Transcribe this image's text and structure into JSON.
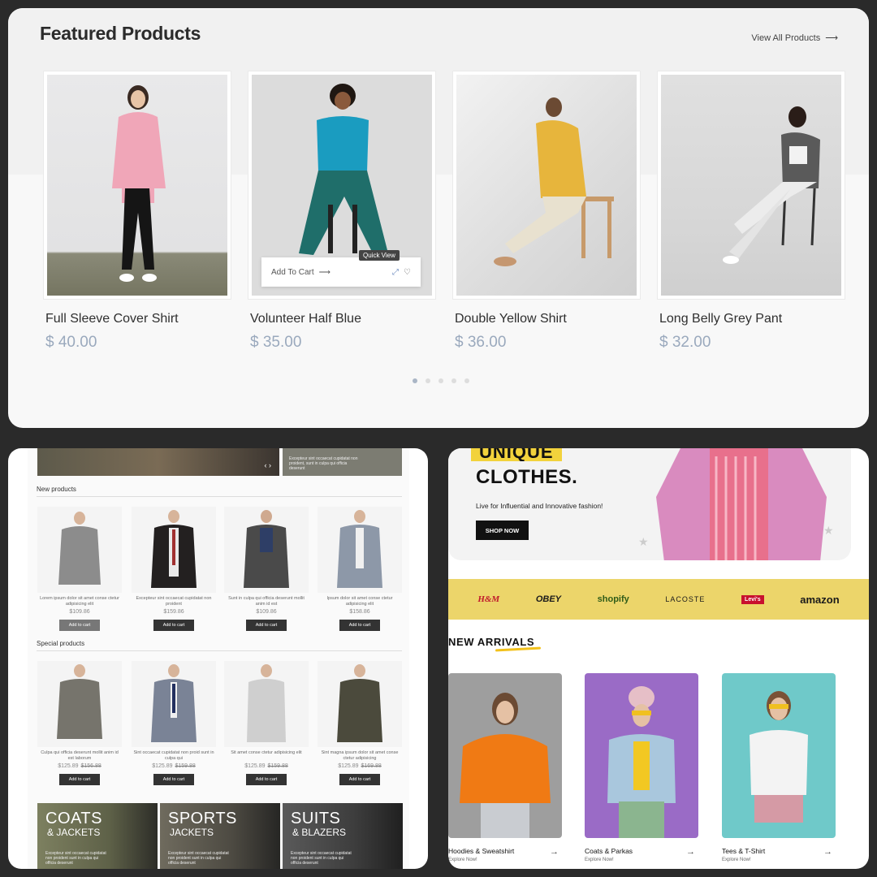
{
  "featured": {
    "title": "Featured Products",
    "view_all": "View All Products",
    "products": [
      {
        "name": "Full Sleeve Cover Shirt",
        "price": "$ 40.00"
      },
      {
        "name": "Volunteer Half Blue",
        "price": "$ 35.00"
      },
      {
        "name": "Double Yellow Shirt",
        "price": "$ 36.00"
      },
      {
        "name": "Long Belly Grey Pant",
        "price": "$ 32.00"
      }
    ],
    "add_to_cart": "Add To Cart",
    "quick_view": "Quick View",
    "active_slide": 1,
    "slide_count": 5
  },
  "shop": {
    "new_products_label": "New products",
    "special_products_label": "Special products",
    "new_products": [
      {
        "desc": "Lorem ipsum dolor sit amet conse ctetur adipisicing elit",
        "price": "$109.86",
        "btn": "Add to cart"
      },
      {
        "desc": "Excepteur sint occaecat cupidatat non proident",
        "price": "$159.86",
        "btn": "Add to cart"
      },
      {
        "desc": "Sunt in culpa qui officia deserunt mollit anim id est",
        "price": "$109.86",
        "btn": "Add to cart"
      },
      {
        "desc": "Ipsum dolor sit amet conse ctetur adipisicing elit",
        "price": "$158.86",
        "btn": "Add to cart"
      }
    ],
    "special_products": [
      {
        "desc": "Culpa qui officia deserunt mollit anim id est laborum",
        "price": "$125.89",
        "old": "$156.88",
        "btn": "Add to cart"
      },
      {
        "desc": "Sint occaecat cupidatat non proid sunt in culpa qui",
        "price": "$125.89",
        "old": "$159.88",
        "btn": "Add to cart"
      },
      {
        "desc": "Sit amet conse ctetur adipisicing elit",
        "price": "$125.89",
        "old": "$159.88",
        "btn": "Add to cart"
      },
      {
        "desc": "Sint magna ipsum dolor sit amet conse ctetur adipisicing",
        "price": "$125.89",
        "old": "$169.88",
        "btn": "Add to cart"
      }
    ],
    "categories": [
      {
        "t1": "COATS",
        "t2": "& JACKETS",
        "t3": "Excepteur sint occaecat cupidatat non proident sunt in culpa qui officia deserunt"
      },
      {
        "t1": "SPORTS",
        "t2": "JACKETS",
        "t3": "Excepteur sint occaecat cupidatat non proident sunt in culpa qui officia deserunt"
      },
      {
        "t1": "SUITS",
        "t2": "& BLAZERS",
        "t3": "Excepteur sint occaecat cupidatat non proident sunt in culpa qui officia deserunt"
      }
    ],
    "banner_text": "Excepteur sint occaecat cupidatat non proident, sunt in culpa qui officia deserunt"
  },
  "fashion": {
    "unique": "UNIQUE",
    "clothes": "CLOTHES.",
    "tagline": "Live for Influential and Innovative fashion!",
    "shop_now": "SHOP NOW",
    "brands": [
      "H&M",
      "OBEY",
      "shopify",
      "LACOSTE",
      "Levi's",
      "amazon"
    ],
    "new_arrivals": "NEW ARRIVALS",
    "arrivals": [
      {
        "label": "Hoodies & Sweatshirt",
        "sub": "Explore Now!"
      },
      {
        "label": "Coats & Parkas",
        "sub": "Explore Now!"
      },
      {
        "label": "Tees & T-Shirt",
        "sub": "Explore Now!"
      }
    ],
    "colors": {
      "accent": "#f2d23c",
      "brand_strip": "#ecd56a"
    }
  }
}
